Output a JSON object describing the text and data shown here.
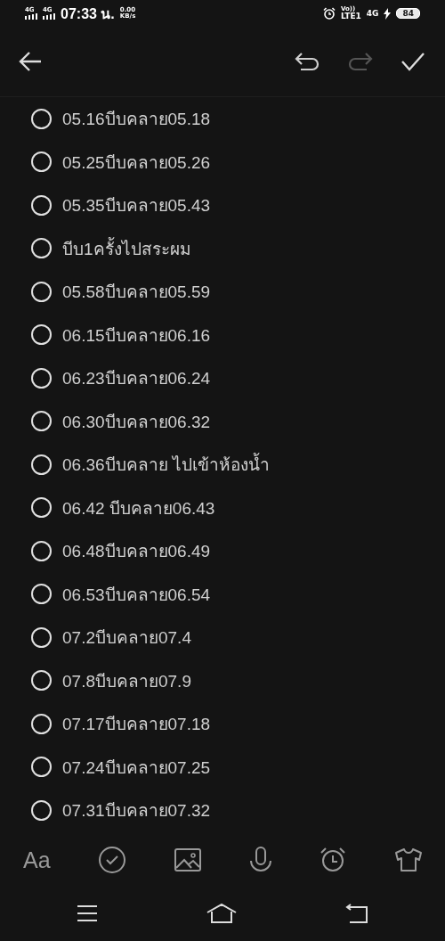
{
  "status_bar": {
    "network_1": "4G",
    "network_2": "4G",
    "time": "07:33 น.",
    "speed_value": "0.00",
    "speed_unit": "KB/s",
    "volte_top": "Vo))",
    "volte_bottom": "LTE1",
    "network_3": "4G",
    "battery": "84"
  },
  "header": {
    "undo_enabled": true,
    "redo_enabled": false
  },
  "checklist": [
    {
      "text": "05.16บีบคลาย05.18",
      "checked": false
    },
    {
      "text": "05.25บีบคลาย05.26",
      "checked": false
    },
    {
      "text": "05.35บีบคลาย05.43",
      "checked": false
    },
    {
      "text": "บีบ1ครั้งไปสระผม",
      "checked": false
    },
    {
      "text": "05.58บีบคลาย05.59",
      "checked": false
    },
    {
      "text": "06.15บีบคลาย06.16",
      "checked": false
    },
    {
      "text": "06.23บีบคลาย06.24",
      "checked": false
    },
    {
      "text": "06.30บีบคลาย06.32",
      "checked": false
    },
    {
      "text": "06.36บีบคลาย ไปเข้าห้องน้ำ",
      "checked": false
    },
    {
      "text": "06.42 บีบคลาย06.43",
      "checked": false
    },
    {
      "text": "06.48บีบคลาย06.49",
      "checked": false
    },
    {
      "text": "06.53บีบคลาย06.54",
      "checked": false
    },
    {
      "text": "07.2บีบคลาย07.4",
      "checked": false
    },
    {
      "text": "07.8บีบคลาย07.9",
      "checked": false
    },
    {
      "text": "07.17บีบคลาย07.18",
      "checked": false
    },
    {
      "text": "07.24บีบคลาย07.25",
      "checked": false
    },
    {
      "text": "07.31บีบคลาย07.32",
      "checked": false
    }
  ],
  "toolbar": {
    "font_button": "Aa"
  }
}
